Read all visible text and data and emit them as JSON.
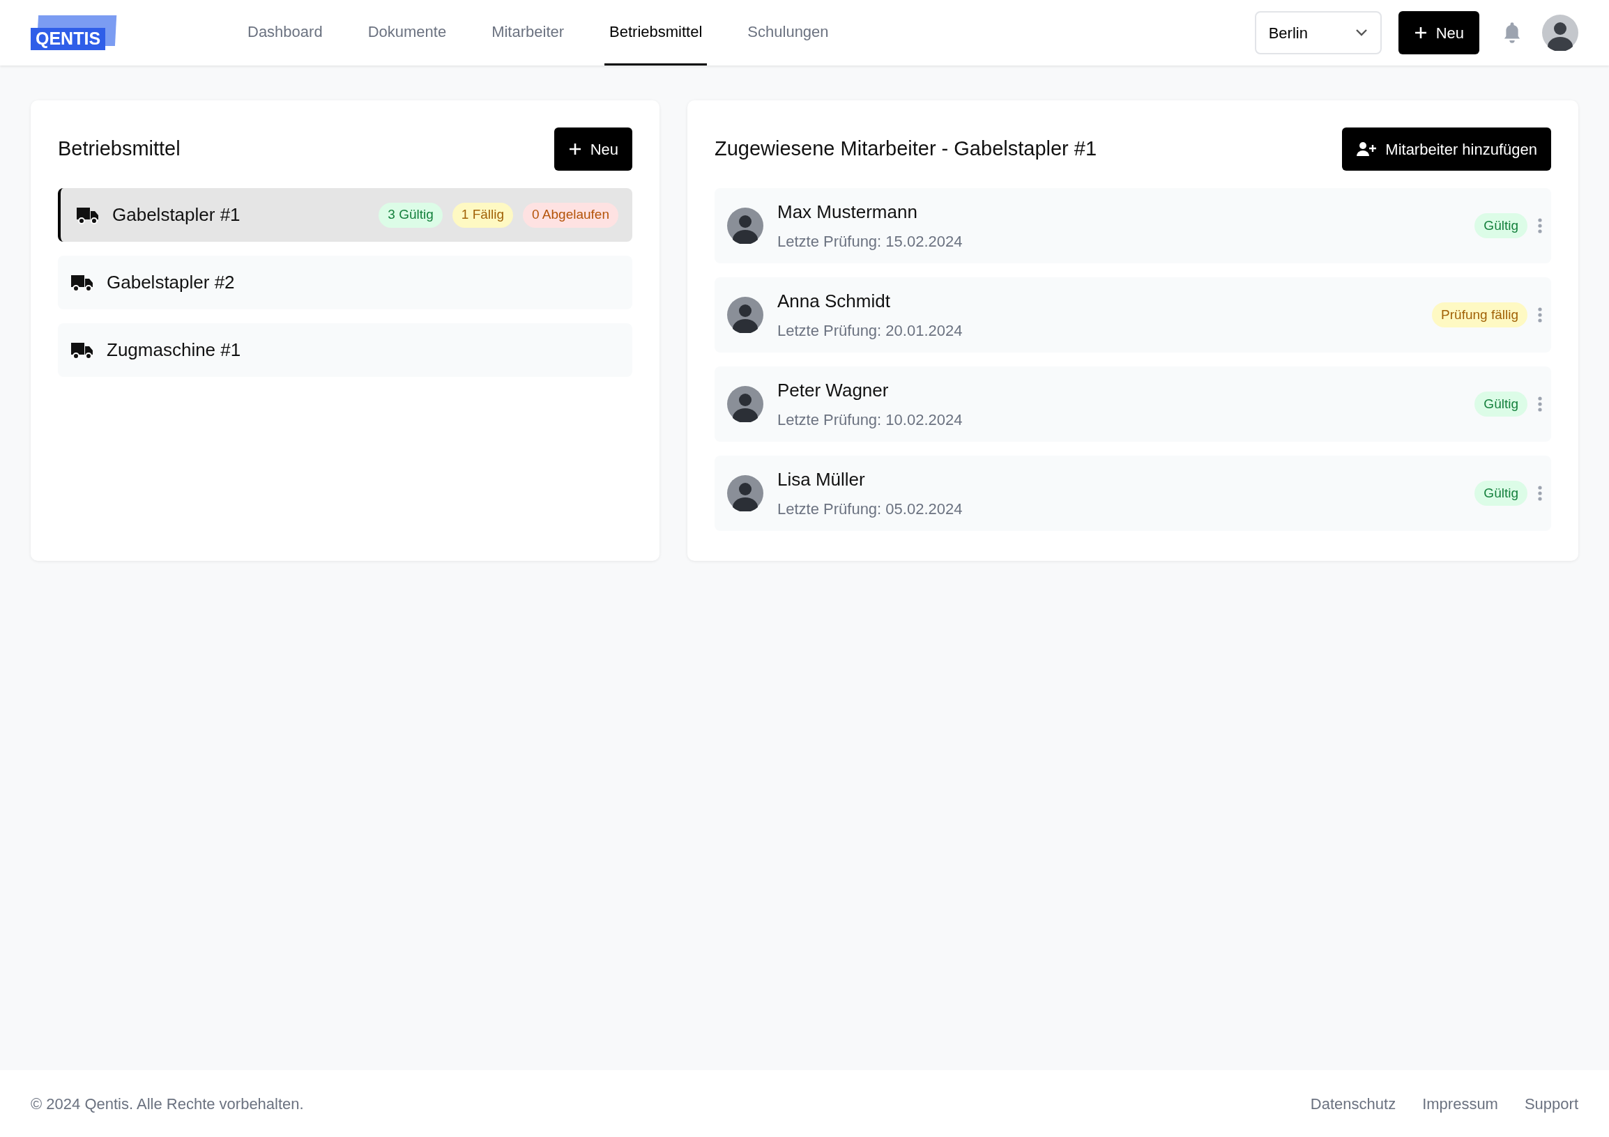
{
  "header": {
    "logo": "QENTIS",
    "nav": [
      {
        "label": "Dashboard",
        "selected": false
      },
      {
        "label": "Dokumente",
        "selected": false
      },
      {
        "label": "Mitarbeiter",
        "selected": false
      },
      {
        "label": "Betriebsmittel",
        "selected": true
      },
      {
        "label": "Schulungen",
        "selected": false
      }
    ],
    "location": "Berlin",
    "new_button": "Neu"
  },
  "assets": {
    "title": "Betriebsmittel",
    "new_button": "Neu",
    "items": [
      {
        "name": "Gabelstapler #1",
        "selected": true,
        "badges": [
          {
            "text": "3 Gültig",
            "kind": "valid"
          },
          {
            "text": "1 Fällig",
            "kind": "due"
          },
          {
            "text": "0 Abgelaufen",
            "kind": "expired"
          }
        ]
      },
      {
        "name": "Gabelstapler #2",
        "selected": false
      },
      {
        "name": "Zugmaschine #1",
        "selected": false
      }
    ]
  },
  "employees": {
    "title": "Zugewiesene Mitarbeiter - Gabelstapler #1",
    "add_button": "Mitarbeiter hinzufügen",
    "items": [
      {
        "name": "Max Mustermann",
        "last_check": "Letzte Prüfung: 15.02.2024",
        "status": {
          "text": "Gültig",
          "kind": "valid"
        }
      },
      {
        "name": "Anna Schmidt",
        "last_check": "Letzte Prüfung: 20.01.2024",
        "status": {
          "text": "Prüfung fällig",
          "kind": "due"
        }
      },
      {
        "name": "Peter Wagner",
        "last_check": "Letzte Prüfung: 10.02.2024",
        "status": {
          "text": "Gültig",
          "kind": "valid"
        }
      },
      {
        "name": "Lisa Müller",
        "last_check": "Letzte Prüfung: 05.02.2024",
        "status": {
          "text": "Gültig",
          "kind": "valid"
        }
      }
    ]
  },
  "footer": {
    "copyright": "© 2024 Qentis. Alle Rechte vorbehalten.",
    "links": [
      "Datenschutz",
      "Impressum",
      "Support"
    ]
  }
}
